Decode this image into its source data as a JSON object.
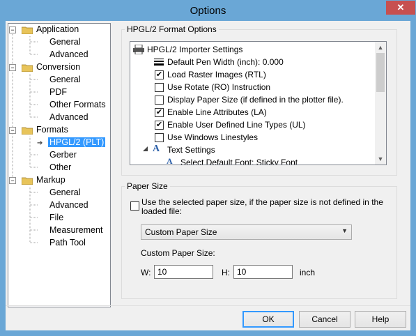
{
  "window": {
    "title": "Options",
    "close_glyph": "✕"
  },
  "tree": {
    "application": {
      "label": "Application",
      "children": [
        "General",
        "Advanced"
      ]
    },
    "conversion": {
      "label": "Conversion",
      "children": [
        "General",
        "PDF",
        "Other Formats",
        "Advanced"
      ]
    },
    "formats": {
      "label": "Formats",
      "children": [
        "HPGL/2 (PLT)",
        "Gerber",
        "Other"
      ]
    },
    "markup": {
      "label": "Markup",
      "children": [
        "General",
        "Advanced",
        "File",
        "Measurement",
        "Path Tool"
      ]
    }
  },
  "hpgl": {
    "group_label": "HPGL/2 Format Options",
    "header": "HPGL/2 Importer Settings",
    "pen_width": "Default Pen Width (inch): 0.000",
    "options": [
      {
        "label": "Load Raster Images (RTL)",
        "checked": true
      },
      {
        "label": "Use Rotate (RO) Instruction",
        "checked": false
      },
      {
        "label": "Display Paper Size (if defined in the plotter file).",
        "checked": false
      },
      {
        "label": "Enable Line Attributes (LA)",
        "checked": true
      },
      {
        "label": "Enable User Defined Line Types (UL)",
        "checked": true
      },
      {
        "label": "Use Windows Linestyles",
        "checked": false
      }
    ],
    "text_settings": "Text Settings",
    "default_font": "Select Default Font: Sticky Font"
  },
  "paper": {
    "group_label": "Paper Size",
    "checkbox_label_line1": "Use the selected paper size, if the paper size is not defined in the",
    "checkbox_label_line2": "loaded file:",
    "checked": false,
    "dropdown_value": "Custom Paper Size",
    "custom_label": "Custom Paper Size:",
    "w_label": "W:",
    "w_value": "10",
    "h_label": "H:",
    "h_value": "10",
    "unit": "inch"
  },
  "buttons": {
    "ok": "OK",
    "cancel": "Cancel",
    "help": "Help"
  }
}
